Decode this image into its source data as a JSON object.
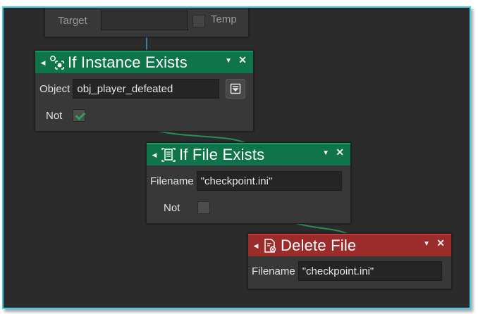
{
  "top_node": {
    "target_label": "Target",
    "temp_label": "Temp"
  },
  "if_instance": {
    "title": "If Instance Exists",
    "header_color": "#10744b",
    "object_label": "Object",
    "object_value": "obj_player_defeated",
    "not_label": "Not",
    "not_checked": true
  },
  "if_file": {
    "title": "If File Exists",
    "header_color": "#10744b",
    "filename_label": "Filename",
    "filename_value": "\"checkpoint.ini\"",
    "not_label": "Not",
    "not_checked": false
  },
  "delete_file": {
    "title": "Delete File",
    "header_color": "#9c2c2c",
    "filename_label": "Filename",
    "filename_value": "\"checkpoint.ini\""
  },
  "icons": {
    "collapse": "triangle-left-icon",
    "dropdown": "triangle-down-icon",
    "close": "close-icon",
    "instance": "instance-icon",
    "file_exists": "file-exists-icon",
    "delete_file": "delete-file-icon",
    "object_picker": "object-picker-icon"
  },
  "colors": {
    "frame_border": "#3fd0ec",
    "canvas": "#2b2b2b",
    "connector": "#2e8b57",
    "accent_link": "#3a7ca5"
  }
}
